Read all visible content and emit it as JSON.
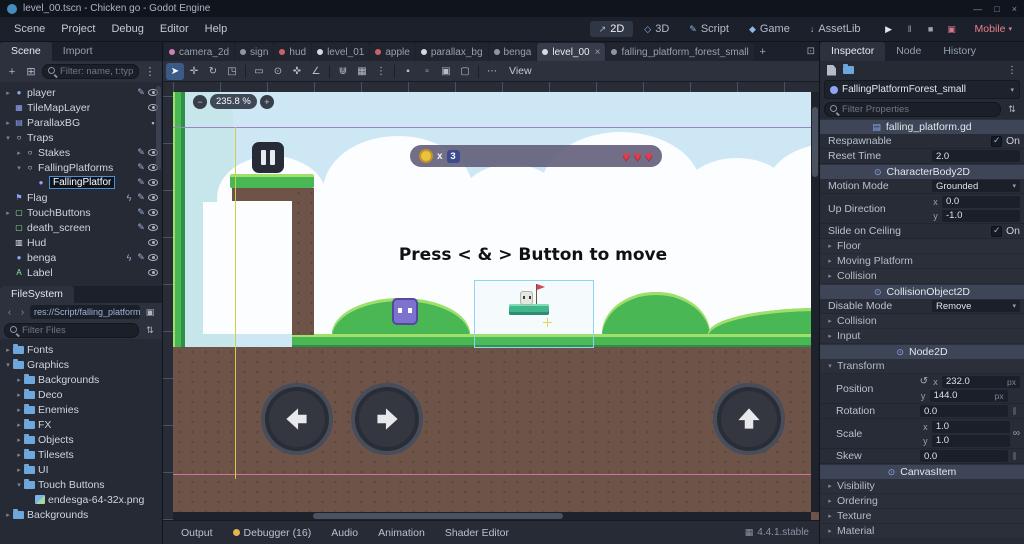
{
  "titlebar": {
    "title": "level_00.tscn - Chicken go - Godot Engine",
    "controls": [
      {
        "name": "minimize",
        "glyph": "—"
      },
      {
        "name": "maximize",
        "glyph": "□"
      },
      {
        "name": "close",
        "glyph": "×"
      }
    ]
  },
  "glyphs": {
    "dropdown": "▾",
    "back": "‹",
    "forward": "›",
    "expand": "⊡",
    "kebab": "⋮",
    "bookmark": "▣",
    "sort": "⇅"
  },
  "menubar": {
    "menus": [
      "Scene",
      "Project",
      "Debug",
      "Editor",
      "Help"
    ],
    "workspaces": [
      {
        "label": "2D",
        "glyph": "↗",
        "active": true
      },
      {
        "label": "3D",
        "glyph": "◇"
      },
      {
        "label": "Script",
        "glyph": "✎"
      },
      {
        "label": "Game",
        "glyph": "◆"
      },
      {
        "label": "AssetLib",
        "glyph": "↓"
      }
    ],
    "run_buttons": [
      {
        "name": "play",
        "glyph": "▶",
        "color": "#dfe5ee"
      },
      {
        "name": "pause",
        "glyph": "‖",
        "color": "#9aa3b2"
      },
      {
        "name": "stop",
        "glyph": "■",
        "color": "#9aa3b2"
      },
      {
        "name": "movie-mode",
        "glyph": "▣",
        "color": "#d9778a"
      }
    ],
    "renderer": "Mobile",
    "renderer_color": "#e9808c"
  },
  "scene_panel": {
    "tabs": [
      {
        "label": "Scene",
        "active": true
      },
      {
        "label": "Import"
      }
    ],
    "toolbar": {
      "add": "+",
      "instance": "⊞"
    },
    "filter_placeholder": "Filter: name, t:type",
    "tree": [
      {
        "label": "player",
        "depth": 1,
        "arrow": "closed",
        "glyph": "●",
        "color": "#8da5f3",
        "right": [
          "script",
          "eye"
        ]
      },
      {
        "label": "TileMapLayer",
        "depth": 1,
        "glyph": "▦",
        "color": "#8da5f3",
        "right": [
          "eye"
        ]
      },
      {
        "label": "ParallaxBG",
        "depth": 1,
        "arrow": "closed",
        "glyph": "▤",
        "color": "#8da5f3",
        "right": [
          "lock"
        ]
      },
      {
        "label": "Traps",
        "depth": 1,
        "arrow": "open",
        "glyph": "○",
        "color": "#e8ecf4",
        "right": []
      },
      {
        "label": "Stakes",
        "depth": 2,
        "arrow": "closed",
        "glyph": "○",
        "color": "#e8ecf4",
        "right": [
          "script",
          "eye"
        ]
      },
      {
        "label": "FallingPlatforms",
        "depth": 2,
        "arrow": "open",
        "glyph": "○",
        "color": "#e8ecf4",
        "right": [
          "script",
          "eye"
        ]
      },
      {
        "label": "FallingPlatfor",
        "depth": 3,
        "editing": true,
        "glyph": "●",
        "color": "#8da5f3",
        "right": [
          "script",
          "eye"
        ]
      },
      {
        "label": "Flag",
        "depth": 1,
        "glyph": "⚑",
        "color": "#8da5f3",
        "right": [
          "signal",
          "script",
          "eye"
        ]
      },
      {
        "label": "TouchButtons",
        "depth": 1,
        "arrow": "closed",
        "glyph": "▢",
        "color": "#8eef97",
        "right": [
          "script",
          "eye"
        ]
      },
      {
        "label": "death_screen",
        "depth": 1,
        "glyph": "▢",
        "color": "#8eef97",
        "right": [
          "script",
          "eye"
        ]
      },
      {
        "label": "Hud",
        "depth": 1,
        "glyph": "▥",
        "color": "#e8ecf4",
        "right": [
          "eye"
        ]
      },
      {
        "label": "benga",
        "depth": 1,
        "glyph": "●",
        "color": "#8da5f3",
        "right": [
          "signal",
          "script",
          "eye"
        ]
      },
      {
        "label": "Label",
        "depth": 1,
        "glyph": "A",
        "color": "#8eef97",
        "right": [
          "eye"
        ]
      }
    ]
  },
  "filesystem": {
    "title": "FileSystem",
    "path": "res://Script/falling_platform.g",
    "filter_placeholder": "Filter Files",
    "tree": [
      {
        "label": "Fonts",
        "depth": 1,
        "type": "folder",
        "arrow": "closed"
      },
      {
        "label": "Graphics",
        "depth": 1,
        "type": "folder",
        "arrow": "open"
      },
      {
        "label": "Backgrounds",
        "depth": 2,
        "type": "folder",
        "arrow": "closed"
      },
      {
        "label": "Deco",
        "depth": 2,
        "type": "folder",
        "arrow": "closed"
      },
      {
        "label": "Enemies",
        "depth": 2,
        "type": "folder",
        "arrow": "closed"
      },
      {
        "label": "FX",
        "depth": 2,
        "type": "folder",
        "arrow": "closed"
      },
      {
        "label": "Objects",
        "depth": 2,
        "type": "folder",
        "arrow": "closed"
      },
      {
        "label": "Tilesets",
        "depth": 2,
        "type": "folder",
        "arrow": "closed"
      },
      {
        "label": "UI",
        "depth": 2,
        "type": "folder",
        "arrow": "closed"
      },
      {
        "label": "Touch Buttons",
        "depth": 2,
        "type": "folder",
        "arrow": "open"
      },
      {
        "label": "endesga-64-32x.png",
        "depth": 3,
        "type": "image"
      },
      {
        "label": "Backgrounds",
        "depth": 1,
        "type": "folder",
        "arrow": "closed"
      }
    ]
  },
  "scene_tabs": {
    "tabs": [
      {
        "label": "camera_2d",
        "color": "#d98ec0"
      },
      {
        "label": "sign",
        "color": "#9aa3b2"
      },
      {
        "label": "hud",
        "color": "#e06a6a"
      },
      {
        "label": "level_01",
        "color": "#e8ecf4"
      },
      {
        "label": "apple",
        "color": "#e06a6a"
      },
      {
        "label": "parallax_bg",
        "color": "#e8ecf4"
      },
      {
        "label": "benga",
        "color": "#9aa3b2"
      },
      {
        "label": "level_00",
        "color": "#e8ecf4",
        "active": true,
        "close": "×"
      },
      {
        "label": "falling_platform_forest_small",
        "color": "#9aa3b2"
      }
    ],
    "add_glyph": "+"
  },
  "canvas_toolbar": {
    "tools": [
      {
        "name": "select-tool",
        "glyph": "➤",
        "active": true
      },
      {
        "name": "move-tool",
        "glyph": "✛"
      },
      {
        "name": "rotate-tool",
        "glyph": "↻"
      },
      {
        "name": "scale-tool",
        "glyph": "◳"
      },
      {
        "sep": true
      },
      {
        "name": "list-select-tool",
        "glyph": "▭"
      },
      {
        "name": "pivot-tool",
        "glyph": "⊙"
      },
      {
        "name": "pan-tool",
        "glyph": "✜"
      },
      {
        "name": "ruler-tool",
        "glyph": "∠"
      },
      {
        "sep": true
      },
      {
        "name": "smart-snap",
        "glyph": "⋓"
      },
      {
        "name": "grid-snap",
        "glyph": "▦"
      },
      {
        "name": "snap-options",
        "glyph": "⋮"
      },
      {
        "sep": true
      },
      {
        "name": "lock-object",
        "glyph": "▪"
      },
      {
        "name": "unlock-object",
        "glyph": "▫"
      },
      {
        "name": "group-object",
        "glyph": "▣"
      },
      {
        "name": "ungroup-object",
        "glyph": "▢"
      },
      {
        "sep": true
      },
      {
        "name": "more-options",
        "glyph": "⋯"
      }
    ],
    "view_label": "View"
  },
  "viewport": {
    "zoom_out": "−",
    "zoom_value": "235.8 %",
    "zoom_in": "+",
    "message": "Press < & > Button to move",
    "game_hud": {
      "coin_label": "x",
      "coin_count": "3",
      "hearts": 3
    }
  },
  "bottom_bar": {
    "items": [
      {
        "label": "Output"
      },
      {
        "label": "Debugger (16)",
        "dot": true
      },
      {
        "label": "Audio"
      },
      {
        "label": "Animation"
      },
      {
        "label": "Shader Editor"
      }
    ],
    "version": "4.4.1.stable"
  },
  "inspector": {
    "tabs": [
      {
        "label": "Inspector",
        "active": true
      },
      {
        "label": "Node"
      },
      {
        "label": "History"
      }
    ],
    "selected_node": "FallingPlatformForest_small",
    "filter_placeholder": "Filter Properties",
    "sections": [
      {
        "type": "script",
        "label": "falling_platform.gd"
      },
      {
        "type": "prop",
        "label": "Respawnable",
        "control": "toggle",
        "value": "On"
      },
      {
        "type": "prop",
        "label": "Reset Time",
        "control": "number",
        "value": "2.0"
      },
      {
        "type": "category",
        "label": "CharacterBody2D"
      },
      {
        "type": "prop",
        "label": "Motion Mode",
        "control": "dropdown",
        "value": "Grounded"
      },
      {
        "type": "vector",
        "label": "Up Direction",
        "axes": [
          {
            "axis": "x",
            "value": "0.0"
          },
          {
            "axis": "y",
            "value": "-1.0"
          }
        ]
      },
      {
        "type": "prop",
        "label": "Slide on Ceiling",
        "control": "toggle",
        "value": "On"
      },
      {
        "type": "group",
        "label": "Floor"
      },
      {
        "type": "group",
        "label": "Moving Platform"
      },
      {
        "type": "group",
        "label": "Collision"
      },
      {
        "type": "category",
        "label": "CollisionObject2D"
      },
      {
        "type": "prop",
        "label": "Disable Mode",
        "control": "dropdown",
        "value": "Remove"
      },
      {
        "type": "group",
        "label": "Collision"
      },
      {
        "type": "group",
        "label": "Input"
      },
      {
        "type": "category",
        "label": "Node2D"
      },
      {
        "type": "group",
        "label": "Transform",
        "open": true
      },
      {
        "type": "vector",
        "label": "Position",
        "indent": true,
        "revert": true,
        "axes": [
          {
            "axis": "x",
            "value": "232.0",
            "suffix": "px"
          },
          {
            "axis": "y",
            "value": "144.0",
            "suffix": "px"
          }
        ]
      },
      {
        "type": "prop",
        "label": "Rotation",
        "indent": true,
        "control": "slider",
        "value": "0.0"
      },
      {
        "type": "vector",
        "label": "Scale",
        "indent": true,
        "link": true,
        "axes": [
          {
            "axis": "x",
            "value": "1.0"
          },
          {
            "axis": "y",
            "value": "1.0"
          }
        ]
      },
      {
        "type": "prop",
        "label": "Skew",
        "indent": true,
        "control": "slider",
        "value": "0.0"
      },
      {
        "type": "category",
        "label": "CanvasItem"
      },
      {
        "type": "group",
        "label": "Visibility"
      },
      {
        "type": "group",
        "label": "Ordering"
      },
      {
        "type": "group",
        "label": "Texture"
      },
      {
        "type": "group",
        "label": "Material"
      }
    ]
  },
  "colors": {
    "accent_blue": "#699ce8",
    "godot_blue": "#478cbf",
    "sky": "#cde8f4",
    "grass": "#49b854",
    "dirt": "#6d5348",
    "heart_red": "#e23b4e",
    "coin_yellow": "#ecc23c",
    "selection_box": "#8fd4f2",
    "guide_purple": "#9b85c4",
    "guide_pink": "#d070a0",
    "guide_yellow": "#c9cf4f",
    "renderer_mobile": "#e9808c"
  }
}
